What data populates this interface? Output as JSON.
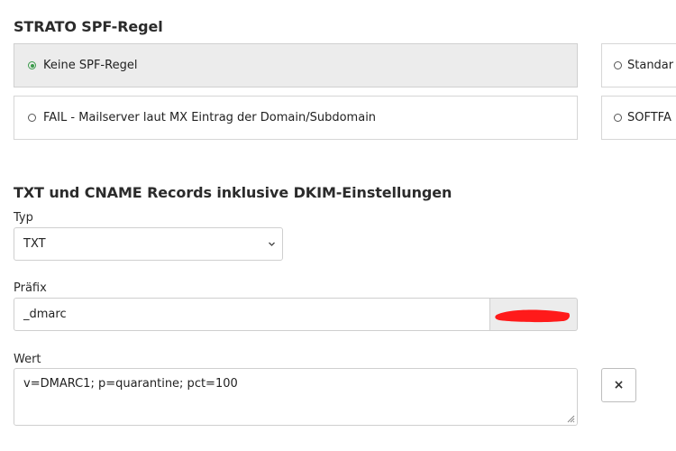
{
  "spf": {
    "title": "STRATO SPF-Regel",
    "options": [
      {
        "label": "Keine SPF-Regel",
        "selected": true
      },
      {
        "label": "Standar",
        "selected": false
      },
      {
        "label": "FAIL - Mailserver laut MX Eintrag der Domain/Subdomain",
        "selected": false
      },
      {
        "label": "SOFTFA",
        "selected": false
      }
    ]
  },
  "records": {
    "title": "TXT und CNAME Records inklusive DKIM-Einstellungen",
    "type_label": "Typ",
    "type_value": "TXT",
    "prefix_label": "Präfix",
    "prefix_value": "_dmarc",
    "value_label": "Wert",
    "value_text": "v=DMARC1; p=quarantine; pct=100",
    "remove_button": "×"
  },
  "colors": {
    "radio_selected": "#3a9a4a",
    "redaction": "#ff1a1a"
  }
}
